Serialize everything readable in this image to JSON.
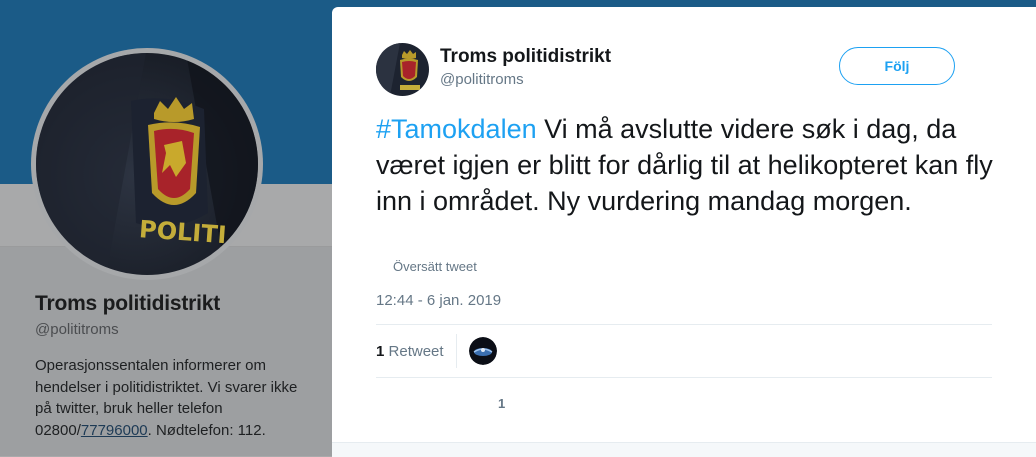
{
  "profile": {
    "name": "Troms politidistrikt",
    "handle": "@polititroms",
    "bio_line1": "Operasjonssentalen informerer om",
    "bio_line2": "hendelser i politidistriktet. Vi svarer ikke",
    "bio_line3": "på twitter, bruk heller telefon",
    "bio_phone_prefix": "02800/",
    "bio_phone_link": "77796000",
    "bio_suffix": ". Nødtelefon: 112.",
    "badge_text": "POLITI"
  },
  "tweet": {
    "author_name": "Troms politidistrikt",
    "author_handle": "@polititroms",
    "follow_label": "Följ",
    "hashtag": "#Tamokdalen",
    "text": " Vi må avslutte videre søk i dag, da været igjen er blitt for dårlig til at helikopteret kan fly inn i området. Ny vurdering mandag morgen.",
    "translate_label": "Översätt tweet",
    "timestamp": "12:44 - 6 jan. 2019",
    "retweet_count": "1",
    "retweet_label": "Retweet",
    "action_count": "1"
  },
  "colors": {
    "accent": "#1da1f2",
    "banner": "#1b5b87",
    "text_primary": "#14171a",
    "text_secondary": "#657786"
  },
  "icons": {
    "profile_avatar": "police-badge-avatar",
    "author_avatar": "police-badge-avatar",
    "retweeter_avatar": "user-avatar"
  }
}
